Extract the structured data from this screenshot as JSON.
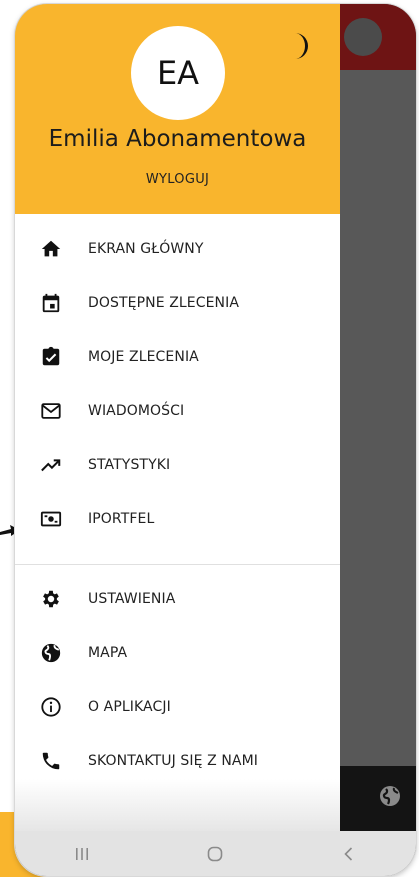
{
  "user": {
    "initials": "EA",
    "name": "Emilia Abonamentowa",
    "logout_label": "WYLOGUJ"
  },
  "menu": {
    "main": [
      {
        "label": "EKRAN GŁÓWNY",
        "icon": "home-icon"
      },
      {
        "label": "DOSTĘPNE ZLECENIA",
        "icon": "calendar-icon"
      },
      {
        "label": "MOJE ZLECENIA",
        "icon": "clipboard-check-icon"
      },
      {
        "label": "WIADOMOŚCI",
        "icon": "mail-icon"
      },
      {
        "label": "STATYSTYKI",
        "icon": "trending-up-icon"
      },
      {
        "label": "IPORTFEL",
        "icon": "money-icon"
      }
    ],
    "secondary": [
      {
        "label": "USTAWIENIA",
        "icon": "gear-icon"
      },
      {
        "label": "MAPA",
        "icon": "globe-icon"
      },
      {
        "label": "O APLIKACJI",
        "icon": "info-icon"
      },
      {
        "label": "SKONTAKTUJ SIĘ Z NAMI",
        "icon": "phone-icon"
      }
    ]
  },
  "colors": {
    "accent": "#f9b52d",
    "overlay": "#585858",
    "text": "#222222"
  },
  "theme_toggle_icon": "moon-icon",
  "system_nav": [
    "recent-apps-icon",
    "home-button-icon",
    "back-icon"
  ]
}
